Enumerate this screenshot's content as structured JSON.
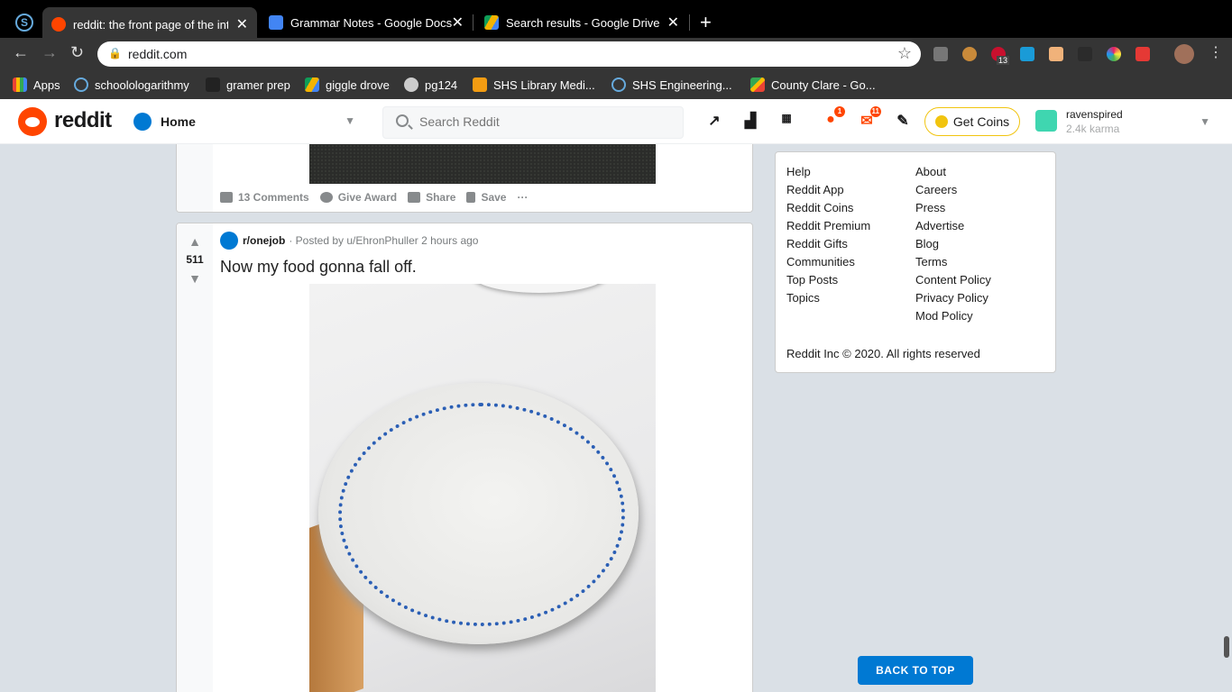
{
  "browser": {
    "tabs": [
      {
        "title": "reddit: the front page of the int",
        "active": true,
        "favicon_color": "#ff4500"
      },
      {
        "title": "Grammar Notes - Google Docs",
        "active": false,
        "favicon_color": "#4285f4"
      },
      {
        "title": "Search results - Google Drive",
        "active": false,
        "favicon_color": "#f4b400"
      }
    ],
    "url": "reddit.com",
    "bookmarks": [
      {
        "label": "Apps",
        "icon": "apps-grid-icon"
      },
      {
        "label": "schoolologarithmy",
        "icon": "schoology-icon"
      },
      {
        "label": "gramer prep",
        "icon": "gb-icon"
      },
      {
        "label": "giggle drove",
        "icon": "google-drive-icon"
      },
      {
        "label": "pg124",
        "icon": "globe-icon"
      },
      {
        "label": "SHS Library Medi...",
        "icon": "library-icon"
      },
      {
        "label": "SHS Engineering...",
        "icon": "schoology-icon"
      },
      {
        "label": "County Clare - Go...",
        "icon": "maps-icon"
      }
    ],
    "extensions": {
      "abp_count": "13"
    }
  },
  "reddit": {
    "brand": "reddit",
    "home_label": "Home",
    "search_placeholder": "Search Reddit",
    "chat_badge": "1",
    "mail_badge": "11",
    "get_coins": "Get Coins",
    "username": "ravenspired",
    "karma": "2.4k karma",
    "accent": "#ff4500"
  },
  "feed": {
    "post1": {
      "comments": "13 Comments",
      "give_award": "Give Award",
      "share": "Share",
      "save": "Save",
      "more": "···"
    },
    "post2": {
      "subreddit": "r/onejob",
      "posted_by": "· Posted by u/EhronPhuller 2 hours ago",
      "score": "511",
      "title": "Now my food gonna fall off."
    }
  },
  "footer": {
    "col1": [
      "Help",
      "Reddit App",
      "Reddit Coins",
      "Reddit Premium",
      "Reddit Gifts",
      "Communities",
      "Top Posts",
      "Topics"
    ],
    "col2": [
      "About",
      "Careers",
      "Press",
      "Advertise",
      "Blog",
      "Terms",
      "Content Policy",
      "Privacy Policy",
      "Mod Policy"
    ],
    "copyright": "Reddit Inc © 2020. All rights reserved"
  },
  "back_to_top": "BACK TO TOP"
}
